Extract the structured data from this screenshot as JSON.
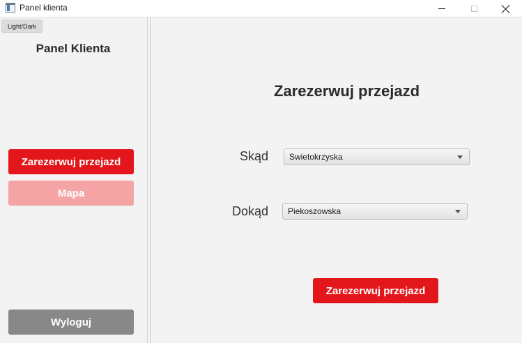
{
  "window": {
    "title": "Panel klienta"
  },
  "sidebar": {
    "theme_toggle": "Light/Dark",
    "title": "Panel Klienta",
    "reserve_button": "Zarezerwuj przejazd",
    "map_button": "Mapa",
    "logout_button": "Wyloguj"
  },
  "main": {
    "title": "Zarezerwuj przejazd",
    "from_label": "Skąd",
    "from_value": "Swietokrzyska",
    "to_label": "Dokąd",
    "to_value": "Piekoszowska",
    "submit_button": "Zarezerwuj przejazd"
  },
  "colors": {
    "accent": "#e3161b",
    "accent_disabled": "#f4a4a5",
    "logout": "#888888"
  }
}
